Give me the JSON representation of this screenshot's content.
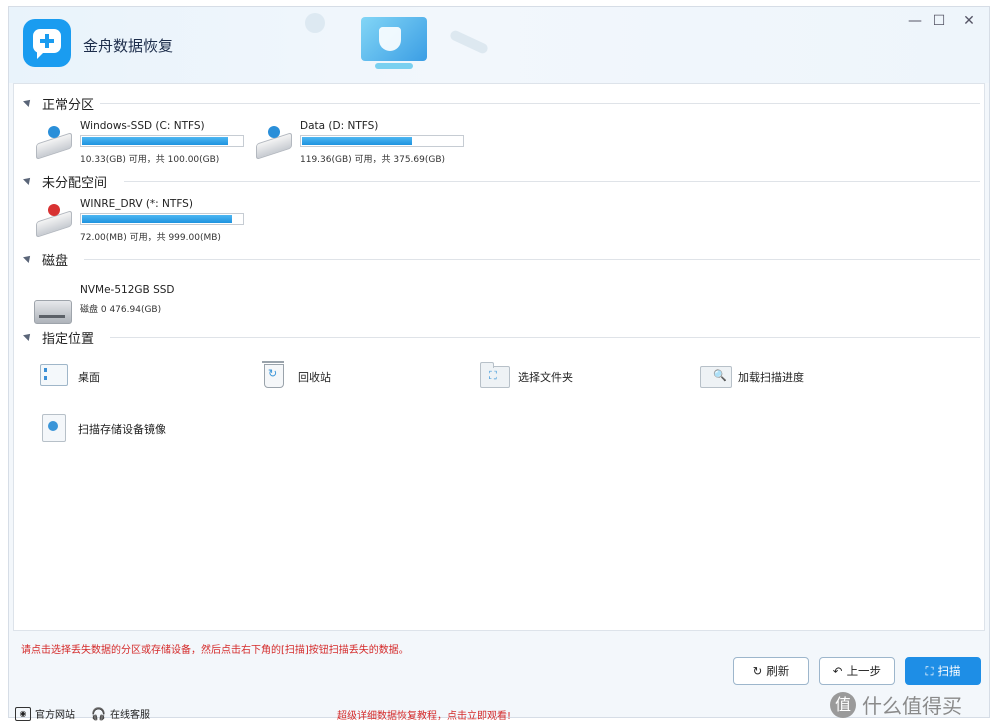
{
  "app": {
    "title": "金舟数据恢复"
  },
  "window_controls": {
    "minimize": "—",
    "maximize": "☐",
    "close": "✕"
  },
  "sections": {
    "normal": "正常分区",
    "unallocated": "未分配空间",
    "disk": "磁盘",
    "location": "指定位置"
  },
  "partitions": [
    {
      "name": "Windows-SSD (C: NTFS)",
      "size": "10.33(GB) 可用，共 100.00(GB)",
      "fill_fraction": 0.9
    },
    {
      "name": "Data (D: NTFS)",
      "size": "119.36(GB) 可用，共 375.69(GB)",
      "fill_fraction": 0.68
    }
  ],
  "unallocated": [
    {
      "name": "WINRE_DRV (*: NTFS)",
      "size": "72.00(MB) 可用，共 999.00(MB)",
      "fill_fraction": 0.92
    }
  ],
  "disks": [
    {
      "name": "NVMe-512GB SSD",
      "size": "磁盘 0    476.94(GB)"
    }
  ],
  "locations": {
    "desktop": "桌面",
    "recycle_bin": "回收站",
    "select_folder": "选择文件夹",
    "load_progress": "加载扫描进度",
    "scan_image": "扫描存储设备镜像"
  },
  "hint": "请点击选择丢失数据的分区或存储设备，然后点击右下角的[扫描]按钮扫描丢失的数据。",
  "buttons": {
    "refresh": "刷新",
    "back": "上一步",
    "scan": "扫描"
  },
  "footer": {
    "website": "官方网站",
    "service": "在线客服",
    "promo": "超级详细数据恢复教程，点击立即观看!"
  },
  "watermark": {
    "text": "什么值得买",
    "badge": "值"
  },
  "colors": {
    "accent": "#1e8ee6",
    "hint": "#d42a2a",
    "bar": "#1e93df"
  }
}
